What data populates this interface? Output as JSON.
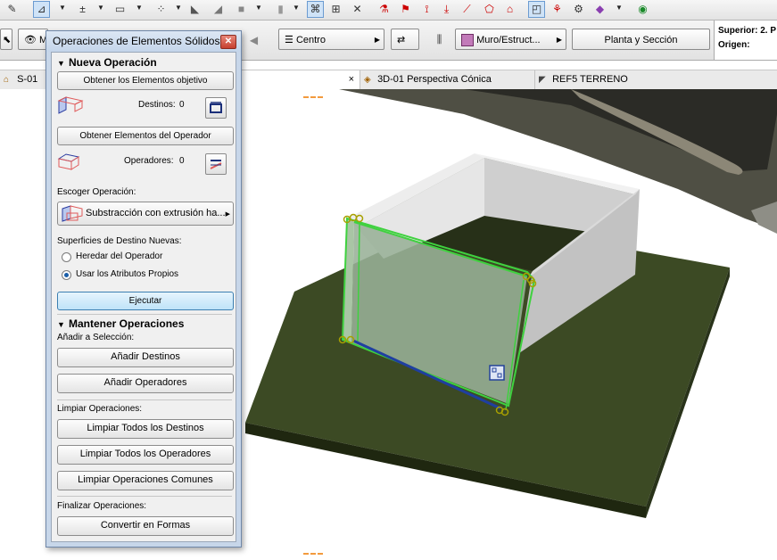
{
  "toolbar_top": {
    "icons": [
      "pencil-icon",
      "pointer-tool-icon",
      "dimension-tool-icon",
      "screen-icon",
      "dotted-grid-icon",
      "wall-icon",
      "box-icon",
      "column-icon",
      "magic-wand-icon",
      "grid-icon",
      "close-x-icon",
      "structure-icon",
      "warning-icon",
      "dim-icon",
      "fill-icon",
      "measure-icon",
      "polygon-icon",
      "home-icon",
      "layer-icon",
      "paint-icon",
      "settings-icon",
      "erase-icon",
      "globe-icon"
    ]
  },
  "toolbar_secondary": {
    "view_button_label": "M",
    "anchor_label": "Centro",
    "wall_type_label": "Muro/Estruct...",
    "view_mode_label": "Planta y Sección"
  },
  "info_panel": {
    "superior_label": "Superior:",
    "superior_value": "2. P",
    "origin_label": "Origen:"
  },
  "tabs": [
    {
      "label": "S-01",
      "active": false
    },
    {
      "label": "",
      "active": true,
      "close": "×"
    },
    {
      "label": "3D-01 Perspectiva Cónica",
      "active": false
    },
    {
      "label": "REF5 TERRENO",
      "active": false
    }
  ],
  "dialog": {
    "title": "Operaciones de Elementos Sólidos",
    "close_label": "✕",
    "new_operation_title": "Nueva Operación",
    "get_targets_label": "Obtener los Elementos objetivo",
    "targets_label": "Destinos:",
    "targets_count": "0",
    "get_operators_label": "Obtener Elementos del Operador",
    "operators_label": "Operadores:",
    "operators_count": "0",
    "choose_operation_label": "Escoger Operación:",
    "operation_value": "Substracción con extrusión ha...",
    "new_surfaces_label": "Superficies de Destino Nuevas:",
    "inherit_label": "Heredar del Operador",
    "inherit_selected": false,
    "own_attributes_label": "Usar los Atributos Propios",
    "own_attributes_selected": true,
    "execute_label": "Ejecutar",
    "maintain_title": "Mantener Operaciones",
    "add_to_selection_label": "Añadir a Selección:",
    "add_targets_label": "Añadir Destinos",
    "add_operators_label": "Añadir Operadores",
    "clear_operations_label": "Limpiar Operaciones:",
    "clear_targets_label": "Limpiar Todos los Destinos",
    "clear_operators_label": "Limpiar Todos los Operadores",
    "clear_common_label": "Limpiar Operaciones Comunes",
    "finalize_label": "Finalizar Operaciones:",
    "convert_label": "Convertir en Formas"
  },
  "colors": {
    "ground": "#3c4a24",
    "wall_light": "#d6d6d6",
    "wall_dark": "#b4b4b4",
    "selection": "#3fd13f",
    "accent_button": "#bfe3f8"
  }
}
